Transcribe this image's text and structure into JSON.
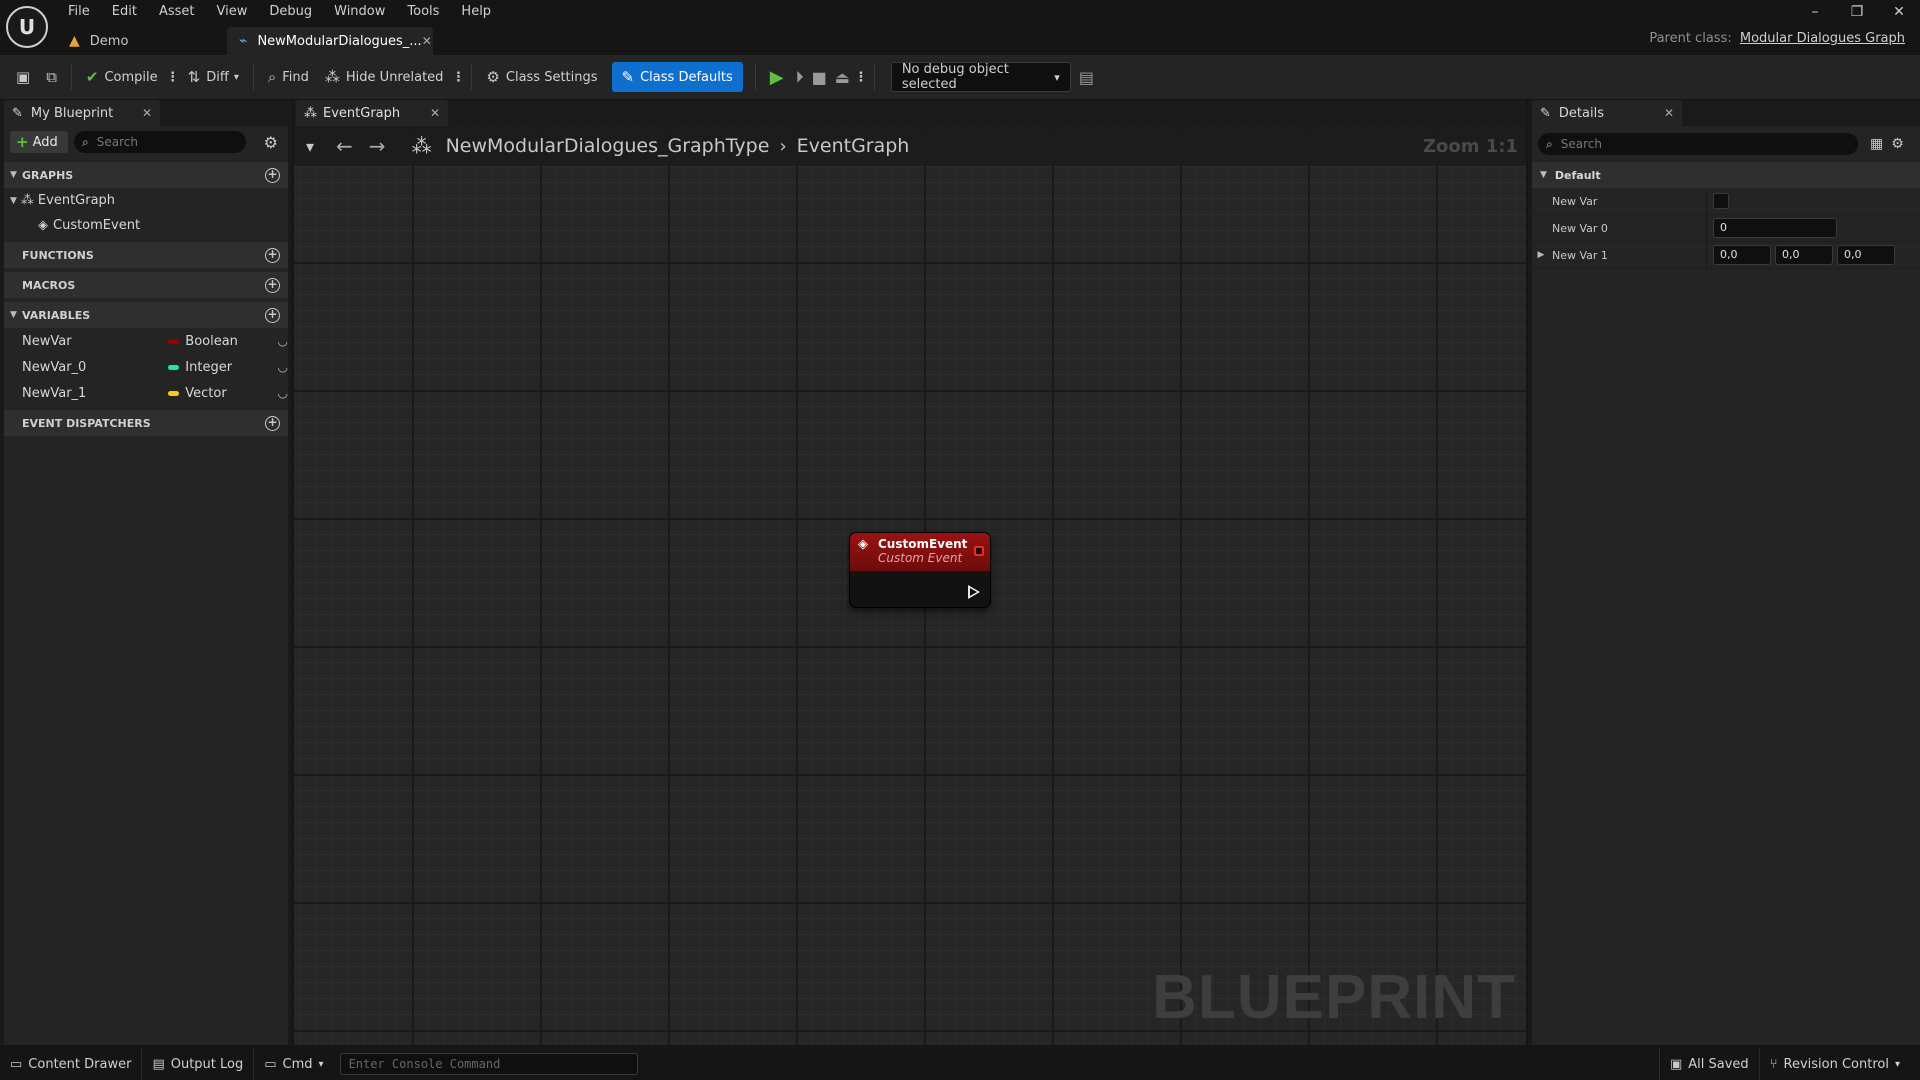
{
  "app": {
    "logo": "ue-logo",
    "menu": [
      "File",
      "Edit",
      "Asset",
      "View",
      "Debug",
      "Window",
      "Tools",
      "Help"
    ],
    "tabs": [
      {
        "label": "Demo",
        "icon": "level-icon"
      },
      {
        "label": "NewModularDialogues_...",
        "icon": "blueprint-icon",
        "active": true
      }
    ],
    "parent_class_label": "Parent class:",
    "parent_class_value": "Modular Dialogues Graph"
  },
  "toolbar": {
    "compile": "Compile",
    "diff": "Diff",
    "find": "Find",
    "hide_unrelated": "Hide Unrelated",
    "class_settings": "Class Settings",
    "class_defaults": "Class Defaults",
    "debug_object": "No debug object selected"
  },
  "my_blueprint": {
    "tab_label": "My Blueprint",
    "add_label": "Add",
    "search_placeholder": "Search",
    "sections": {
      "graphs": "GRAPHS",
      "functions": "FUNCTIONS",
      "macros": "MACROS",
      "variables": "VARIABLES",
      "event_dispatchers": "EVENT DISPATCHERS"
    },
    "graph_tree": {
      "root": "EventGraph",
      "child": "CustomEvent"
    },
    "variables": [
      {
        "name": "NewVar",
        "type": "Boolean",
        "color": "#9b0000"
      },
      {
        "name": "NewVar_0",
        "type": "Integer",
        "color": "#1fe3a9"
      },
      {
        "name": "NewVar_1",
        "type": "Vector",
        "color": "#fdc81e"
      }
    ]
  },
  "graph": {
    "tab_label": "EventGraph",
    "breadcrumb": [
      "NewModularDialogues_GraphType",
      "EventGraph"
    ],
    "zoom": "Zoom 1:1",
    "watermark": "BLUEPRINT",
    "node": {
      "title": "CustomEvent",
      "subtitle": "Custom Event",
      "header_color": "#8b1010"
    }
  },
  "details": {
    "tab_label": "Details",
    "search_placeholder": "Search",
    "category": "Default",
    "props": {
      "new_var_label": "New Var",
      "new_var_0_label": "New Var 0",
      "new_var_0_value": "0",
      "new_var_1_label": "New Var 1",
      "new_var_1_x": "0,0",
      "new_var_1_y": "0,0",
      "new_var_1_z": "0,0"
    }
  },
  "statusbar": {
    "content_drawer": "Content Drawer",
    "output_log": "Output Log",
    "cmd": "Cmd",
    "console_placeholder": "Enter Console Command",
    "all_saved": "All Saved",
    "revision_control": "Revision Control"
  }
}
